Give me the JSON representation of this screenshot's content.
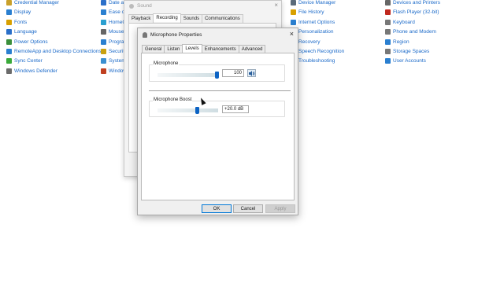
{
  "control_panel": {
    "col1": [
      {
        "label": "Credential Manager",
        "icon": "credential-manager-icon",
        "color": "#c9a02a"
      },
      {
        "label": "Display",
        "icon": "display-icon",
        "color": "#2a7fd0"
      },
      {
        "label": "Fonts",
        "icon": "fonts-icon",
        "color": "#d8a000"
      },
      {
        "label": "Language",
        "icon": "language-icon",
        "color": "#2a6fc9"
      },
      {
        "label": "Power Options",
        "icon": "power-options-icon",
        "color": "#3b8f3b"
      },
      {
        "label": "RemoteApp and Desktop Connections",
        "icon": "remoteapp-icon",
        "color": "#2a7fd0"
      },
      {
        "label": "Sync Center",
        "icon": "sync-center-icon",
        "color": "#3aaa3a"
      },
      {
        "label": "Windows Defender",
        "icon": "windows-defender-icon",
        "color": "#6b6b6b"
      }
    ],
    "col2": [
      {
        "label": "Date an",
        "icon": "date-time-icon",
        "color": "#2a6fc9"
      },
      {
        "label": "Ease of",
        "icon": "ease-of-access-icon",
        "color": "#2a7fd0"
      },
      {
        "label": "HomeG",
        "icon": "homegroup-icon",
        "color": "#2a9fd0"
      },
      {
        "label": "Mouse",
        "icon": "mouse-icon",
        "color": "#666666"
      },
      {
        "label": "Progra",
        "icon": "programs-icon",
        "color": "#2a7fd0"
      },
      {
        "label": "Security",
        "icon": "security-icon",
        "color": "#c8a010"
      },
      {
        "label": "System",
        "icon": "system-icon",
        "color": "#3b8fd0"
      },
      {
        "label": "Window",
        "icon": "windows-icon",
        "color": "#c04020"
      }
    ],
    "col3": [
      {
        "label": "Device Manager",
        "icon": "device-manager-icon",
        "color": "#5a6a7a"
      },
      {
        "label": "File History",
        "icon": "file-history-icon",
        "color": "#d8a000"
      },
      {
        "label": "Internet Options",
        "icon": "internet-options-icon",
        "color": "#2a7fd0"
      },
      {
        "label": "Personalization",
        "icon": "personalization-icon",
        "color": "#2a7fd0"
      },
      {
        "label": "Recovery",
        "icon": "recovery-icon",
        "color": "#2a9fd0"
      },
      {
        "label": "Speech Recognition",
        "icon": "speech-recognition-icon",
        "color": "#777777"
      },
      {
        "label": "Troubleshooting",
        "icon": "troubleshooting-icon",
        "color": "#2a7fd0"
      }
    ],
    "col4": [
      {
        "label": "Devices and Printers",
        "icon": "devices-printers-icon",
        "color": "#666666"
      },
      {
        "label": "Flash Player (32-bit)",
        "icon": "flash-player-icon",
        "color": "#c0281e"
      },
      {
        "label": "Keyboard",
        "icon": "keyboard-icon",
        "color": "#777777"
      },
      {
        "label": "Phone and Modem",
        "icon": "phone-modem-icon",
        "color": "#777777"
      },
      {
        "label": "Region",
        "icon": "region-icon",
        "color": "#2a7fd0"
      },
      {
        "label": "Storage Spaces",
        "icon": "storage-spaces-icon",
        "color": "#777777"
      },
      {
        "label": "User Accounts",
        "icon": "user-accounts-icon",
        "color": "#2a7fd0"
      }
    ]
  },
  "sound_dialog": {
    "title": "Sound",
    "tabs": [
      "Playback",
      "Recording",
      "Sounds",
      "Communications"
    ],
    "active_tab": 1
  },
  "mic_dialog": {
    "title": "Microphone Properties",
    "close": "×",
    "tabs": [
      "General",
      "Listen",
      "Levels",
      "Enhancements",
      "Advanced"
    ],
    "active_tab": 2,
    "microphone": {
      "label": "Microphone",
      "value": "100",
      "level": 1.0
    },
    "boost": {
      "label": "Microphone Boost",
      "value": "+20.0 dB",
      "level": 0.67
    },
    "buttons": {
      "ok": "OK",
      "cancel": "Cancel",
      "apply": "Apply"
    }
  },
  "colors": {
    "link": "#1b6ac9",
    "accent": "#0c63c4"
  }
}
